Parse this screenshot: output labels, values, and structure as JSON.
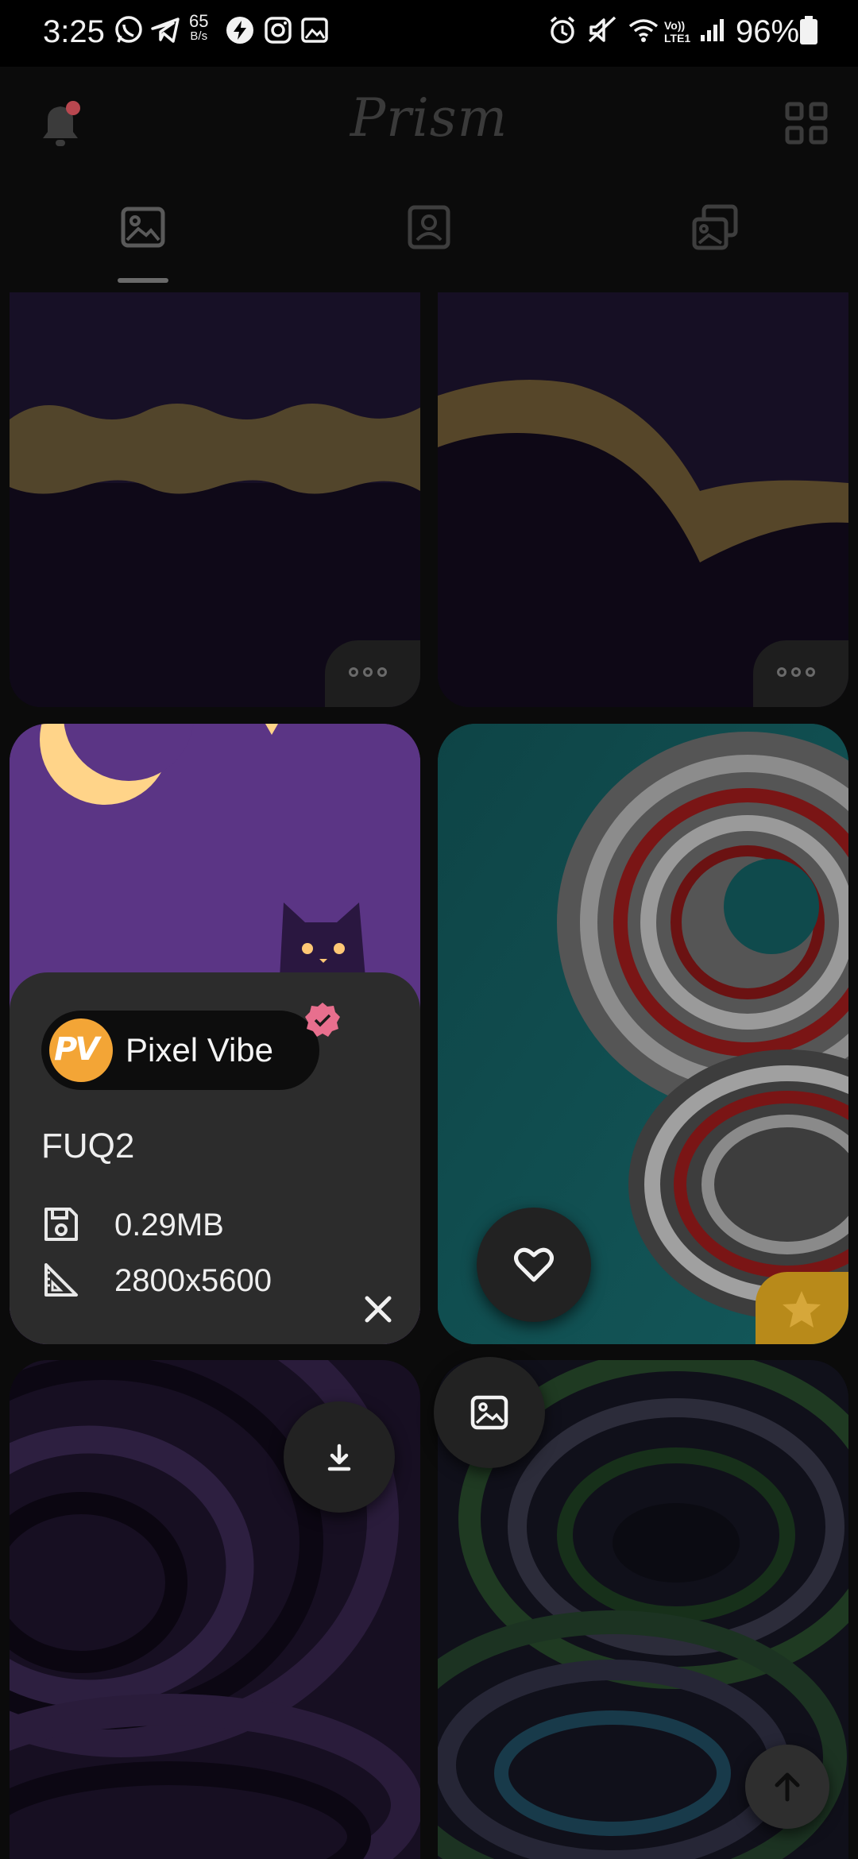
{
  "status_bar": {
    "time": "3:25",
    "net_rate_value": "65",
    "net_rate_unit": "B/s",
    "battery": "96%",
    "lte_label": "Vo)) LTE1"
  },
  "app_bar": {
    "title": "Prism",
    "notification_badge_color": "#b8474f"
  },
  "tabs": {
    "items": [
      {
        "name": "wallpapers",
        "icon": "image-icon",
        "selected": true
      },
      {
        "name": "profiles",
        "icon": "portrait-icon",
        "selected": false
      },
      {
        "name": "setups",
        "icon": "gallery-stack-icon",
        "selected": false
      }
    ]
  },
  "info_panel": {
    "author": "Pixel Vibe",
    "author_logo_text": "PV",
    "wallpaper_id": "FUQ2",
    "size": "0.29MB",
    "resolution": "2800x5600"
  },
  "colors": {
    "accent_pink": "#e86f8e",
    "logo_orange": "#f3a536",
    "moon": "#ffd489",
    "purple_bg": "#5a3484",
    "teal_bg": "#0f4a4c",
    "favorite_star": "#b88a1a"
  }
}
